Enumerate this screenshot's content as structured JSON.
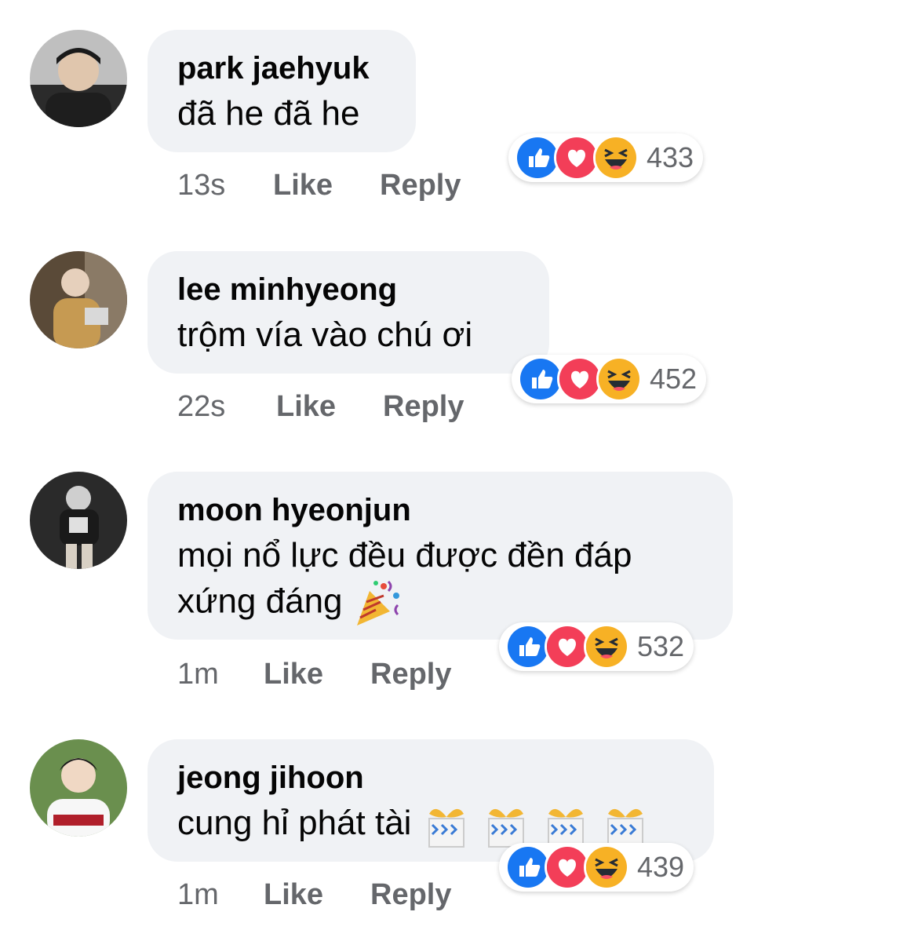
{
  "comments": [
    {
      "name": "park jaehyuk",
      "text_lines": [
        "đã he đã he"
      ],
      "time": "13s",
      "like": "Like",
      "reply": "Reply",
      "reaction_count": "433"
    },
    {
      "name": "lee minhyeong",
      "text_lines": [
        "trộm vía vào chú ơi"
      ],
      "time": "22s",
      "like": "Like",
      "reply": "Reply",
      "reaction_count": "452"
    },
    {
      "name": "moon hyeonjun",
      "text_lines": [
        "mọi nổ lực đều được đền đáp",
        "xứng đáng"
      ],
      "time": "1m",
      "like": "Like",
      "reply": "Reply",
      "reaction_count": "532"
    },
    {
      "name": "jeong jihoon",
      "text_lines": [
        "cung hỉ phát tài"
      ],
      "time": "1m",
      "like": "Like",
      "reply": "Reply",
      "reaction_count": "439"
    }
  ],
  "reaction_icons": [
    "like-icon",
    "love-icon",
    "haha-icon"
  ],
  "colors": {
    "bubble": "#f0f2f5",
    "meta": "#65676b",
    "like_blue": "#1877f2",
    "love_red": "#f33e58",
    "haha_yellow": "#f7b125"
  }
}
